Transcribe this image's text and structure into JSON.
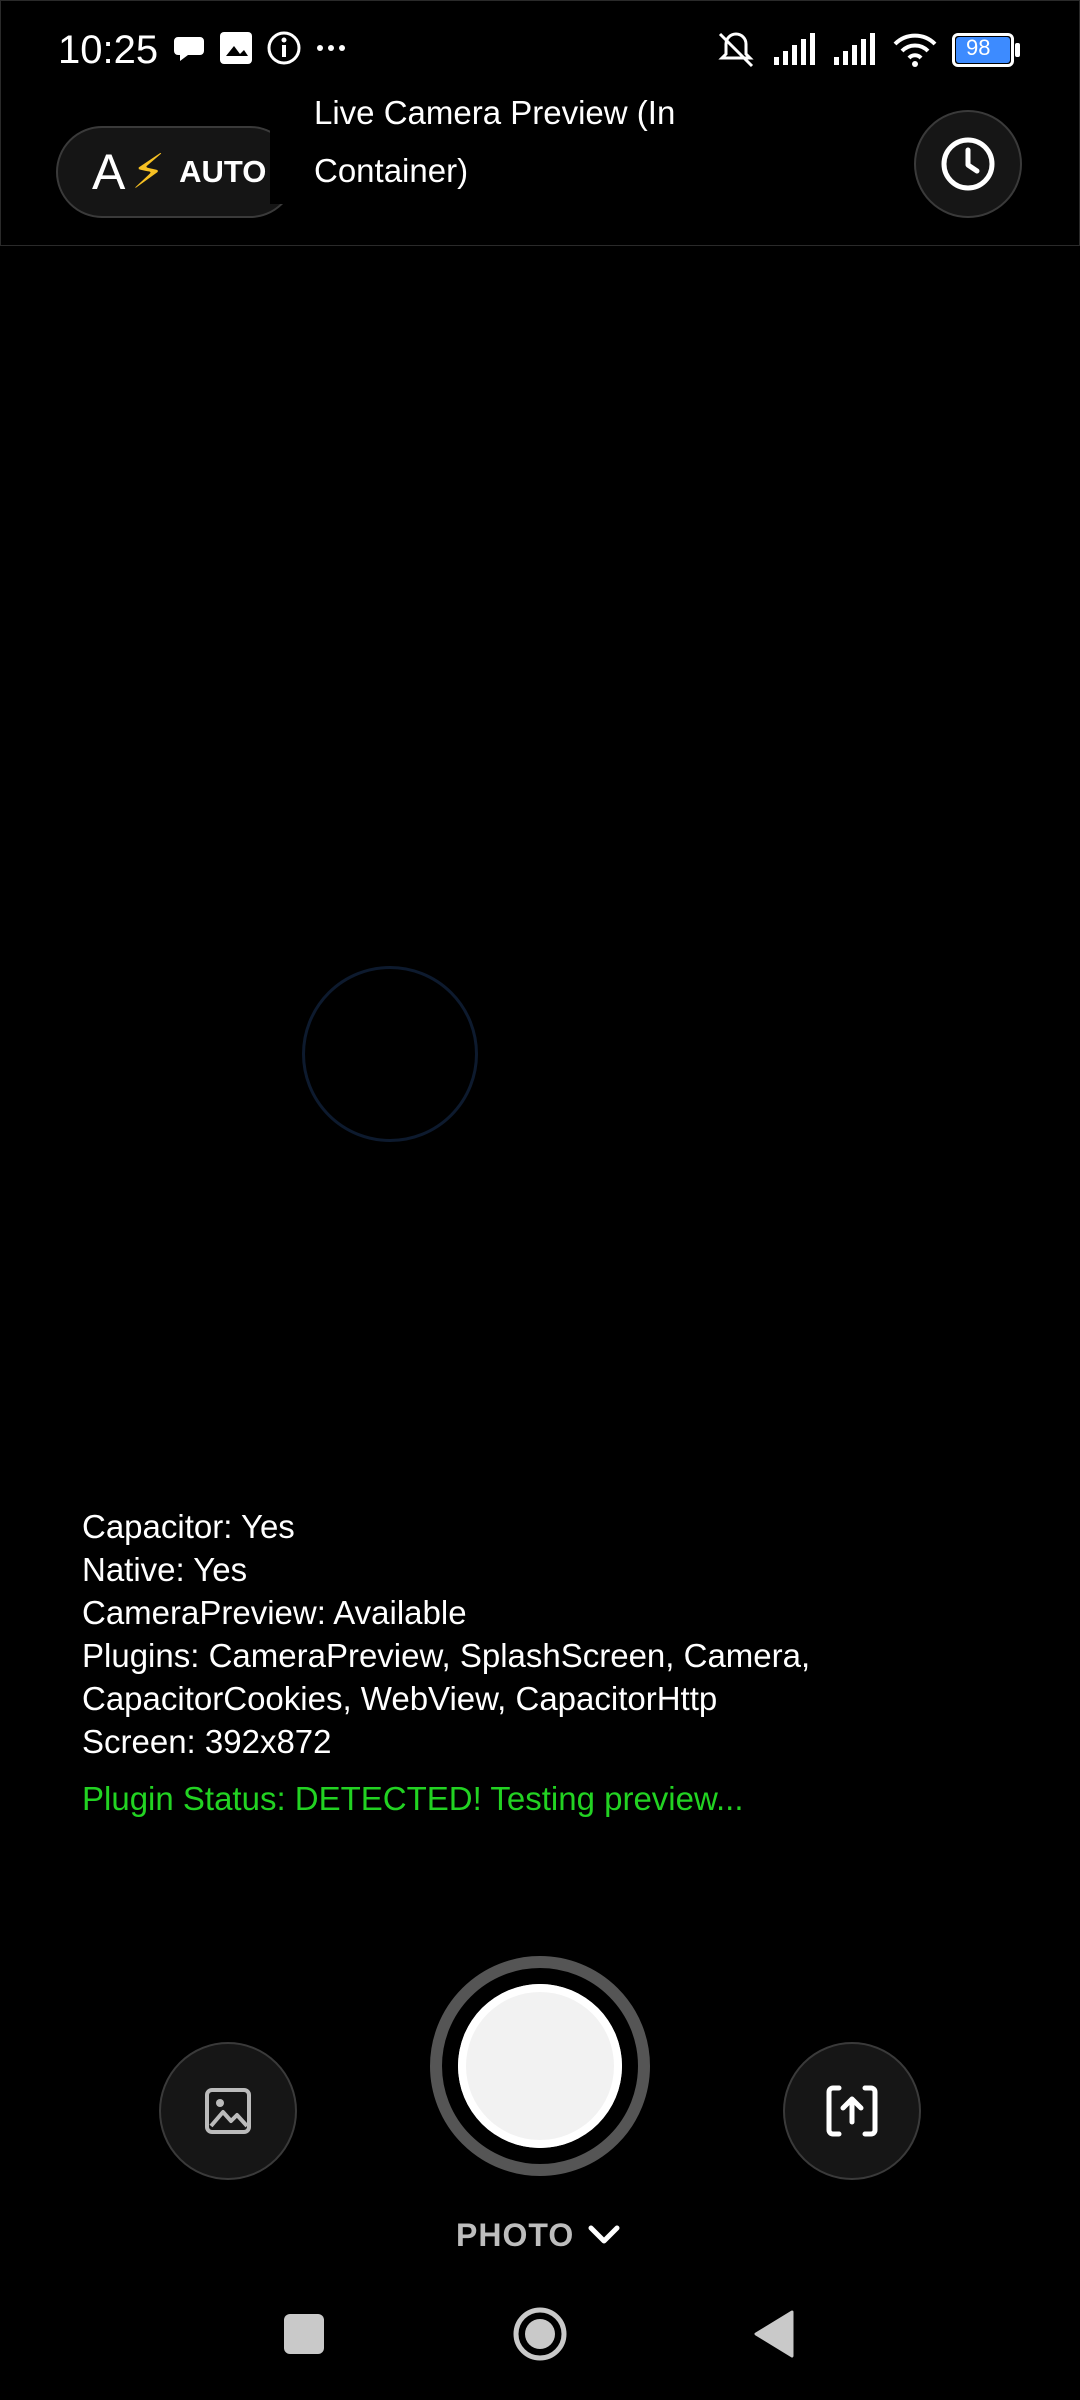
{
  "status_bar": {
    "time": "10:25",
    "battery": "98",
    "left_icons": [
      "chat-bubble-icon",
      "image-notification-icon",
      "info-icon",
      "more-dots-icon"
    ],
    "right_icons": [
      "mute-icon",
      "signal-icon",
      "signal-icon",
      "wifi-icon",
      "battery-icon"
    ]
  },
  "header": {
    "flash_letter": "A",
    "flash_symbol": "⚡",
    "flash_mode": "AUTO",
    "title_line1": "Live Camera Preview (In",
    "title_line2": "Container)",
    "history_icon": "clock-icon"
  },
  "debug_info": {
    "lines": [
      "Capacitor: Yes",
      "Native: Yes",
      "CameraPreview: Available",
      "Plugins: CameraPreview, SplashScreen, Camera,",
      "CapacitorCookies, WebView, CapacitorHttp",
      "Screen: 392x872"
    ],
    "plugin_status": "Plugin Status: DETECTED! Testing preview..."
  },
  "controls": {
    "mode_label": "PHOTO",
    "gallery_icon": "gallery-icon",
    "switch_icon": "camera-switch-icon"
  },
  "colors": {
    "background": "#000000",
    "status_green": "#22d322",
    "flash_yellow": "#f6c023"
  }
}
